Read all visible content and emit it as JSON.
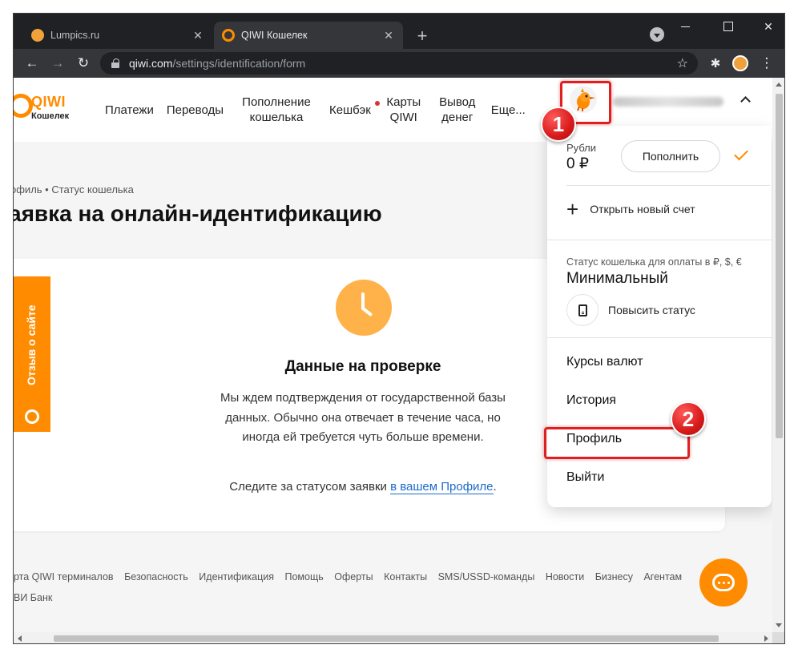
{
  "browser": {
    "tabs": [
      {
        "title": "Lumpics.ru",
        "active": false
      },
      {
        "title": "QIWI Кошелек",
        "active": true
      }
    ],
    "url_domain": "qiwi.com",
    "url_path": "/settings/identification/form"
  },
  "header": {
    "logo_name": "QIWI",
    "logo_sub": "Кошелек",
    "nav": [
      "Платежи",
      "Переводы",
      "Пополнение кошелька",
      "Кешбэк",
      "Карты QIWI",
      "Вывод денег",
      "Еще..."
    ]
  },
  "page": {
    "breadcrumb": "офиль  •  Статус кошелька",
    "title": "аявка на онлайн-идентификацию",
    "feedback_tab": "Отзыв о сайте",
    "status_title": "Данные на проверке",
    "status_text": "Мы ждем подтверждения от государственной базы данных. Обычно она отвечает в течение часа, но иногда ей требуется чуть больше времени.",
    "follow_text": "Следите за статусом заявки ",
    "follow_link": "в вашем Профиле",
    "follow_end": "."
  },
  "dropdown": {
    "balance_label": "Рубли",
    "balance_value": "0 ₽",
    "topup_button": "Пополнить",
    "new_account": "Открыть новый счет",
    "status_label": "Статус кошелька для оплаты в ₽, $, €",
    "status_value": "Минимальный",
    "raise_status": "Повысить статус",
    "menu": [
      "Курсы валют",
      "История",
      "Профиль",
      "Выйти"
    ]
  },
  "footer": {
    "links": [
      "рта QIWI терминалов",
      "Безопасность",
      "Идентификация",
      "Помощь",
      "Оферты",
      "Контакты",
      "SMS/USSD-команды",
      "Новости",
      "Бизнесу",
      "Агентам"
    ],
    "bank": "ВИ Банк"
  },
  "annotations": {
    "marker1": "1",
    "marker2": "2"
  },
  "colors": {
    "brand": "#ff8c00",
    "highlight": "#e02020",
    "link": "#1b6ac9"
  }
}
